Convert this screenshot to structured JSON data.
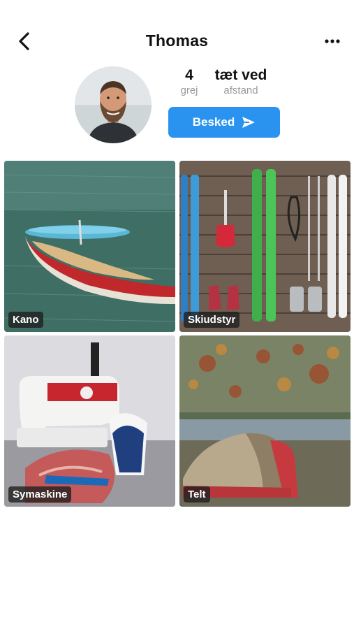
{
  "header": {
    "title": "Thomas",
    "back_icon": "chevron-left-icon",
    "more_icon": "more-horizontal-icon"
  },
  "profile": {
    "stats": [
      {
        "value": "4",
        "label": "grej"
      },
      {
        "value": "tæt ved",
        "label": "afstand"
      }
    ],
    "message_button": {
      "label": "Besked",
      "icon": "send-icon",
      "color": "#2a93f0"
    }
  },
  "items": [
    {
      "label": "Kano"
    },
    {
      "label": "Skiudstyr"
    },
    {
      "label": "Symaskine"
    },
    {
      "label": "Telt"
    }
  ]
}
